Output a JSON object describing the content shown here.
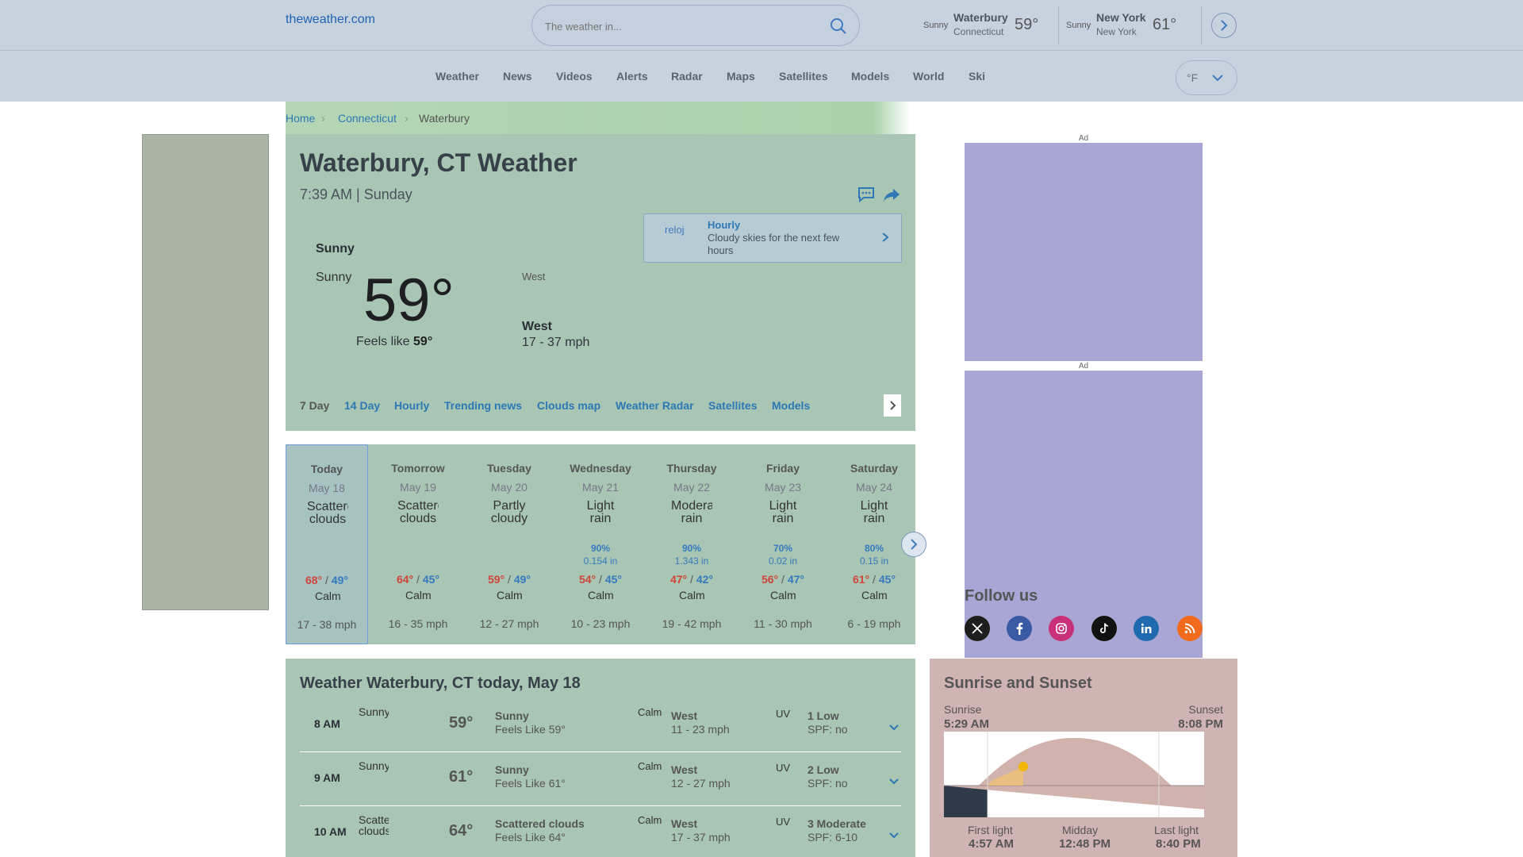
{
  "header": {
    "logo_text": "theweather.com",
    "search_placeholder": "The weather in...",
    "locations": [
      {
        "icon": "Sunny",
        "name": "Waterbury",
        "region": "Connecticut",
        "temp": "59°"
      },
      {
        "icon": "Sunny",
        "name": "New York",
        "region": "New York",
        "temp": "61°"
      }
    ]
  },
  "nav": {
    "items": [
      "Weather",
      "News",
      "Videos",
      "Alerts",
      "Radar",
      "Maps",
      "Satellites",
      "Models",
      "World",
      "Ski"
    ],
    "unit": "°F"
  },
  "breadcrumb": {
    "home": "Home",
    "state": "Connecticut",
    "city": "Waterbury"
  },
  "current": {
    "title": "Waterbury, CT Weather",
    "datetime": "7:39 AM | Sunday",
    "condition": "Sunny",
    "icon_alt": "Sunny",
    "temp": "59°",
    "feels_label": "Feels like",
    "feels_value": "59°",
    "wind_icon_alt": "West",
    "wind_dir": "West",
    "wind_speed": "17 - 37 mph",
    "hourly_icon_alt": "reloj",
    "hourly_title": "Hourly",
    "hourly_desc": "Cloudy skies for the next few hours"
  },
  "subnav": [
    "7 Day",
    "14 Day",
    "Hourly",
    "Trending news",
    "Clouds map",
    "Weather Radar",
    "Satellites",
    "Models"
  ],
  "forecast": [
    {
      "day": "Today",
      "date": "May 18",
      "icon": "Scattered clouds",
      "precip": "",
      "amount": "",
      "hi": "68°",
      "lo": "49°",
      "wind_icon": "Calm",
      "wind": "17 - 38 mph"
    },
    {
      "day": "Tomorrow",
      "date": "May 19",
      "icon": "Scattered clouds",
      "precip": "",
      "amount": "",
      "hi": "64°",
      "lo": "45°",
      "wind_icon": "Calm",
      "wind": "16 - 35 mph"
    },
    {
      "day": "Tuesday",
      "date": "May 20",
      "icon": "Partly cloudy",
      "precip": "",
      "amount": "",
      "hi": "59°",
      "lo": "49°",
      "wind_icon": "Calm",
      "wind": "12 - 27 mph"
    },
    {
      "day": "Wednesday",
      "date": "May 21",
      "icon": "Light rain",
      "precip": "90%",
      "amount": "0.154 in",
      "hi": "54°",
      "lo": "45°",
      "wind_icon": "Calm",
      "wind": "10 - 23 mph"
    },
    {
      "day": "Thursday",
      "date": "May 22",
      "icon": "Moderate rain",
      "precip": "90%",
      "amount": "1.343 in",
      "hi": "47°",
      "lo": "42°",
      "wind_icon": "Calm",
      "wind": "19 - 42 mph"
    },
    {
      "day": "Friday",
      "date": "May 23",
      "icon": "Light rain",
      "precip": "70%",
      "amount": "0.02 in",
      "hi": "56°",
      "lo": "47°",
      "wind_icon": "Calm",
      "wind": "11 - 30 mph"
    },
    {
      "day": "Saturday",
      "date": "May 24",
      "icon": "Light rain",
      "precip": "80%",
      "amount": "0.15 in",
      "hi": "61°",
      "lo": "45°",
      "wind_icon": "Calm",
      "wind": "6 - 19 mph"
    }
  ],
  "ads": {
    "label": "Ad"
  },
  "follow": {
    "title": "Follow us",
    "networks": [
      "x-icon",
      "facebook-icon",
      "instagram-icon",
      "tiktok-icon",
      "linkedin-icon",
      "rss-icon"
    ]
  },
  "today": {
    "title": "Weather Waterbury, CT today, May 18",
    "hours": [
      {
        "time": "8 AM",
        "icon": "Sunny",
        "temp": "59°",
        "cond": "Sunny",
        "feels": "Feels Like 59°",
        "wind_icon": "Calm",
        "wind_dir": "West",
        "wind": "11 - 23 mph",
        "uv_icon": "UV",
        "uv": "1 Low",
        "spf": "SPF: no"
      },
      {
        "time": "9 AM",
        "icon": "Sunny",
        "temp": "61°",
        "cond": "Sunny",
        "feels": "Feels Like 61°",
        "wind_icon": "Calm",
        "wind_dir": "West",
        "wind": "12 - 27 mph",
        "uv_icon": "UV",
        "uv": "2 Low",
        "spf": "SPF: no"
      },
      {
        "time": "10 AM",
        "icon": "Scattered clouds",
        "temp": "64°",
        "cond": "Scattered clouds",
        "feels": "Feels Like 64°",
        "wind_icon": "Calm",
        "wind_dir": "West",
        "wind": "17 - 37 mph",
        "uv_icon": "UV",
        "uv": "3 Moderate",
        "spf": "SPF: 6-10"
      }
    ]
  },
  "sun": {
    "title": "Sunrise and Sunset",
    "sunrise_label": "Sunrise",
    "sunrise": "5:29 AM",
    "sunset_label": "Sunset",
    "sunset": "8:08 PM",
    "first_light_label": "First light",
    "first_light": "4:57 AM",
    "midday_label": "Midday",
    "midday": "12:48 PM",
    "last_light_label": "Last light",
    "last_light": "8:40 PM"
  }
}
